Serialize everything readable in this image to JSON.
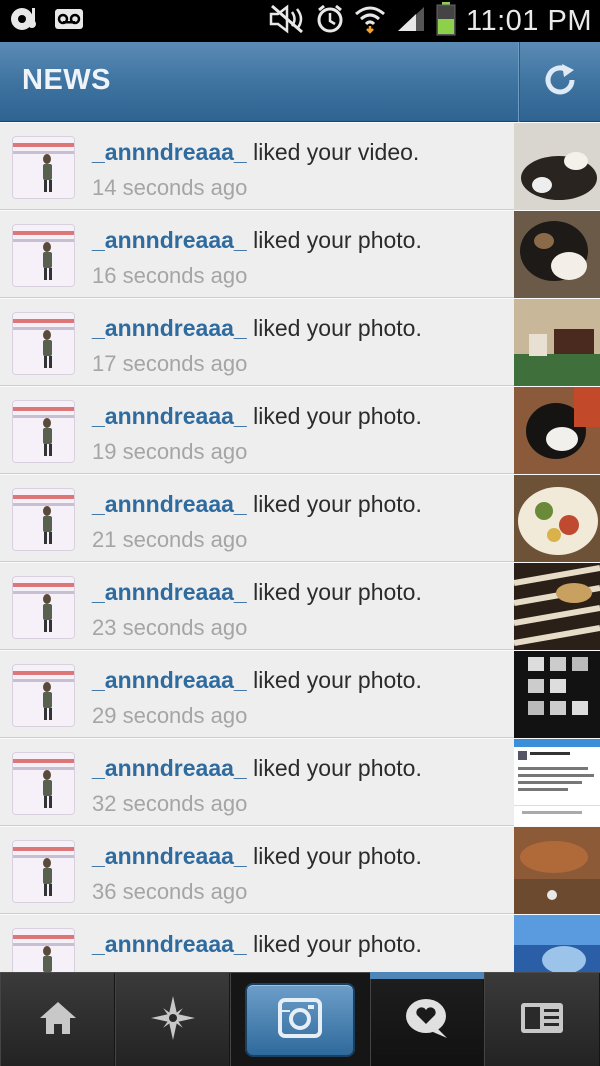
{
  "status_bar": {
    "time": "11:01 PM",
    "icons": [
      "music-icon",
      "voicemail-icon",
      "mute-icon",
      "alarm-icon",
      "wifi-icon",
      "signal-icon",
      "battery-icon"
    ]
  },
  "header": {
    "title": "NEWS",
    "refresh_icon": "refresh-icon"
  },
  "notifications": [
    {
      "username": "_annndreaaa_",
      "action": " liked your video.",
      "time": "14 seconds ago"
    },
    {
      "username": "_annndreaaa_",
      "action": " liked your photo.",
      "time": "16 seconds ago"
    },
    {
      "username": "_annndreaaa_",
      "action": " liked your photo.",
      "time": "17 seconds ago"
    },
    {
      "username": "_annndreaaa_",
      "action": " liked your photo.",
      "time": "19 seconds ago"
    },
    {
      "username": "_annndreaaa_",
      "action": " liked your photo.",
      "time": "21 seconds ago"
    },
    {
      "username": "_annndreaaa_",
      "action": " liked your photo.",
      "time": "23 seconds ago"
    },
    {
      "username": "_annndreaaa_",
      "action": " liked your photo.",
      "time": "29 seconds ago"
    },
    {
      "username": "_annndreaaa_",
      "action": " liked your photo.",
      "time": "32 seconds ago"
    },
    {
      "username": "_annndreaaa_",
      "action": " liked your photo.",
      "time": "36 seconds ago"
    },
    {
      "username": "_annndreaaa_",
      "action": " liked your photo.",
      "time": ""
    }
  ],
  "tabs": [
    {
      "name": "home",
      "icon": "home-icon"
    },
    {
      "name": "explore",
      "icon": "explore-star-icon"
    },
    {
      "name": "camera",
      "icon": "camera-icon"
    },
    {
      "name": "news",
      "icon": "heart-bubble-icon",
      "active": true
    },
    {
      "name": "profile",
      "icon": "profile-card-icon"
    }
  ],
  "colors": {
    "header_blue": "#3f74a1",
    "username_blue": "#2f6b9e",
    "timestamp_gray": "#a5a5a5",
    "active_tab_bar": "#4f86b8"
  }
}
